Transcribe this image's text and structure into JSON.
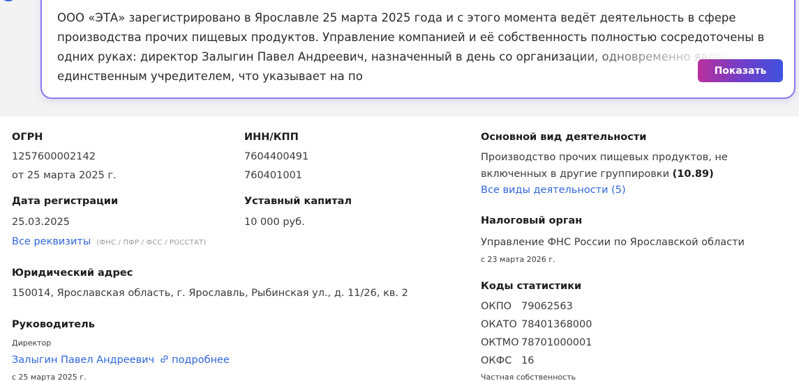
{
  "summary": {
    "text": "ООО «ЭТА» зарегистрировано в Ярославле 25 марта 2025 года и с этого момента ведёт деятельность в сфере производства прочих пищевых продуктов. Управление компанией и её собственность полностью сосредоточены в одних руках: директор Залыгин Павел Андреевич, назначенный в день со организации, одновременно является её единственным учредителем, что указывает на по",
    "show_button": "Показать"
  },
  "ogrn": {
    "label": "ОГРН",
    "value": "1257600002142",
    "date": "от 25 марта 2025 г."
  },
  "inn_kpp": {
    "label": "ИНН/КПП",
    "inn": "7604400491",
    "kpp": "760401001"
  },
  "registration": {
    "label": "Дата регистрации",
    "value": "25.03.2025"
  },
  "capital": {
    "label": "Уставный капитал",
    "value": "10 000 руб."
  },
  "requisites": {
    "link": "Все реквизиты",
    "tag": "(ФНС / ПФР / ФСС / РОССТАТ)"
  },
  "address": {
    "label": "Юридический адрес",
    "value": "150014, Ярославская область, г. Ярославль, Рыбинская ул., д. 11/26, кв. 2"
  },
  "head": {
    "label": "Руководитель",
    "role": "Директор",
    "name": "Залыгин Павел Андреевич",
    "more_link": "подробнее",
    "since": "с 25 марта 2025 г."
  },
  "activity": {
    "label": "Основной вид деятельности",
    "line1": "Производство прочих пищевых продуктов, не",
    "line2": "включенных в другие группировки",
    "code": "(10.89)",
    "all_link": "Все виды деятельности (5)"
  },
  "tax": {
    "label": "Налоговый орган",
    "value": "Управление ФНС России по Ярославской области",
    "since": "с 23 марта 2026 г."
  },
  "stats": {
    "label": "Коды статистики",
    "rows": [
      {
        "key": "ОКПО",
        "value": "79062563"
      },
      {
        "key": "ОКАТО",
        "value": "78401368000"
      },
      {
        "key": "ОКТМО",
        "value": "78701000001"
      },
      {
        "key": "ОКФС",
        "value": "16"
      }
    ],
    "okfs_note": "Частная собственность"
  },
  "colors": {
    "link": "#2f66d8",
    "card_border": "#8b78ee",
    "button_gradient_start": "#b8319d",
    "button_gradient_end": "#3f53e0"
  }
}
